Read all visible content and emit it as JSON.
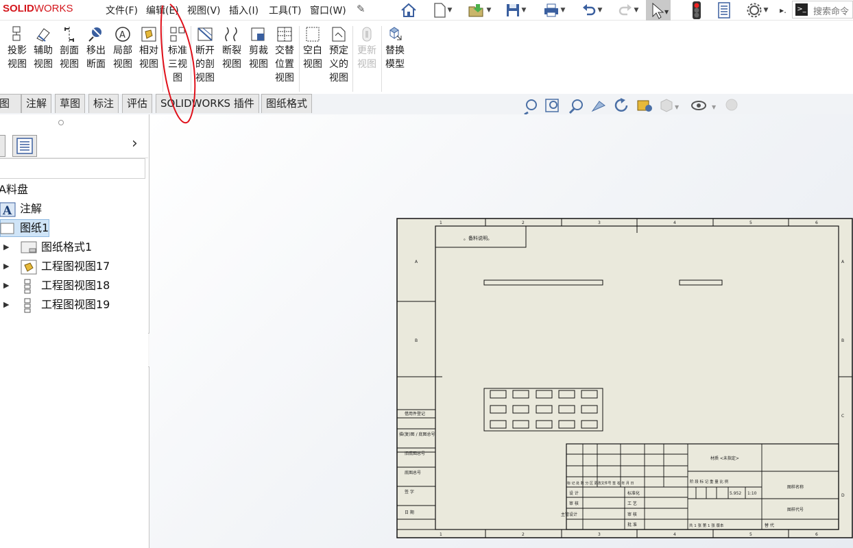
{
  "app": {
    "logo_solid": "SOLID",
    "logo_works": "WORKS",
    "menus": [
      "文件(F)",
      "编辑(E)",
      "视图(V)",
      "插入(I)",
      "工具(T)",
      "窗口(W)"
    ],
    "search_placeholder": "搜索命令",
    "cmd_icon_text": ">_"
  },
  "ribbon": {
    "buttons": [
      {
        "line1": "投影",
        "line2": "视图",
        "line3": ""
      },
      {
        "line1": "辅助",
        "line2": "视图",
        "line3": ""
      },
      {
        "line1": "剖面",
        "line2": "视图",
        "line3": ""
      },
      {
        "line1": "移出",
        "line2": "断面",
        "line3": ""
      },
      {
        "line1": "局部",
        "line2": "视图",
        "line3": ""
      },
      {
        "line1": "相对",
        "line2": "视图",
        "line3": ""
      },
      {
        "line1": "标准",
        "line2": "三视",
        "line3": "图"
      },
      {
        "line1": "断开",
        "line2": "的剖",
        "line3": "视图"
      },
      {
        "line1": "断裂",
        "line2": "视图",
        "line3": ""
      },
      {
        "line1": "剪裁",
        "line2": "视图",
        "line3": ""
      },
      {
        "line1": "交替",
        "line2": "位置",
        "line3": "视图"
      },
      {
        "line1": "空白",
        "line2": "视图",
        "line3": ""
      },
      {
        "line1": "预定",
        "line2": "义的",
        "line3": "视图"
      },
      {
        "line1": "更新",
        "line2": "视图",
        "line3": ""
      },
      {
        "line1": "替换",
        "line2": "模型",
        "line3": ""
      }
    ]
  },
  "tabs": [
    "草图",
    "注解",
    "草图",
    "标注",
    "评估",
    "SOLIDWORKS 插件",
    "图纸格式"
  ],
  "tabs_visible": [
    "图",
    "注解",
    "草图",
    "标注",
    "评估",
    "SOLIDWORKS 插件",
    "图纸格式"
  ],
  "tree": {
    "root": "A料盘",
    "items": [
      {
        "label": "注解",
        "level": 0
      },
      {
        "label": "图纸1",
        "level": 0,
        "selected": true
      },
      {
        "label": "图纸格式1",
        "level": 1
      },
      {
        "label": "工程图视图17",
        "level": 1
      },
      {
        "label": "工程图视图18",
        "level": 1
      },
      {
        "label": "工程图视图19",
        "level": 1
      }
    ]
  },
  "drawing": {
    "zone_numbers_top": [
      "1",
      "2",
      "3",
      "4",
      "5",
      "6"
    ],
    "zone_letters_left": [
      "A",
      "B",
      "C",
      "D"
    ],
    "label_box": "。备料说明。",
    "title_block": {
      "material": "材质 <未指定>",
      "drawing_name": "图样名称",
      "drawing_number": "图样代号",
      "weight": "5.952",
      "scale": "1:10",
      "header_marks": "标 记  处 数  分 区  更改文件号  签 名  年 月 日",
      "stage_labels": "阶 段  标 记  重 量  比 例",
      "design": "设 计",
      "standard": "标准化",
      "check": "审 核",
      "process": "工 艺",
      "main_design": "主管设计",
      "review": "审 核",
      "approve": "批 准",
      "sheet_info": "共 1 张  第 1 张  版本",
      "replace": "替 代"
    },
    "side_labels": [
      "借用件登记",
      "描(复)图 / 底图总号",
      "旧底图总号",
      "底图总号",
      "签  字",
      "日  期"
    ]
  },
  "colors": {
    "accent_blue": "#3a5f9f",
    "logo_red": "#d4161c",
    "sheet_bg": "#eae9dc",
    "annotation_red": "#e0101a"
  }
}
